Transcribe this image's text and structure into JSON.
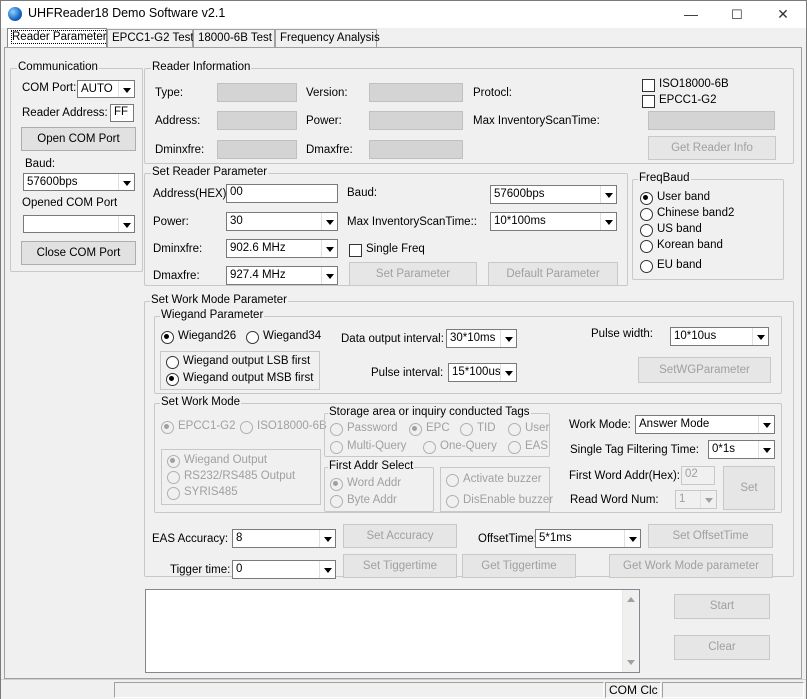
{
  "window": {
    "title": "UHFReader18 Demo Software v2.1",
    "minimize": "—",
    "maximize": "☐",
    "close": "✕"
  },
  "tabs": [
    "Reader Parameter",
    "EPCC1-G2 Test",
    "18000-6B Test",
    "Frequency Analysis"
  ],
  "communication": {
    "title": "Communication",
    "com_port_label": "COM Port:",
    "com_port_value": "AUTO",
    "reader_address_label": "Reader Address:",
    "reader_address_value": "FF",
    "open_com_port": "Open COM Port",
    "baud_label": "Baud:",
    "baud_value": "57600bps",
    "opened_com_port_label": "Opened COM Port",
    "opened_com_port_value": "",
    "close_com_port": "Close COM Port"
  },
  "reader_info": {
    "title": "Reader Information",
    "type_label": "Type:",
    "version_label": "Version:",
    "protocol_label": "Protocl:",
    "address_label": "Address:",
    "power_label": "Power:",
    "max_inv_label": "Max InventoryScanTime:",
    "dminfre_label": "Dminxfre:",
    "dmaxfre_label": "Dmaxfre:",
    "iso_label": "ISO18000-6B",
    "epc_label": "EPCC1-G2",
    "get_reader_info": "Get Reader Info"
  },
  "set_reader_param": {
    "title": "Set Reader Parameter",
    "address_label": "Address(HEX):",
    "address_value": "00",
    "baud_label": "Baud:",
    "baud_value": "57600bps",
    "power_label": "Power:",
    "power_value": "30",
    "max_inv_label": "Max InventoryScanTime::",
    "max_inv_value": "10*100ms",
    "dminfre_label": "Dminxfre:",
    "dminfre_value": "902.6 MHz",
    "single_freq_label": "Single Freq",
    "dmaxfre_label": "Dmaxfre:",
    "dmaxfre_value": "927.4 MHz",
    "set_parameter": "Set Parameter",
    "default_parameter": "Default Parameter"
  },
  "freq_band": {
    "title": "FreqBaud",
    "options": [
      "User band",
      "Chinese band2",
      "US band",
      "Korean band",
      "EU band"
    ],
    "selected": "User band"
  },
  "work_mode_param": {
    "title": "Set Work Mode Parameter",
    "wiegand_title": "Wiegand Parameter",
    "wiegand26": "Wiegand26",
    "wiegand34": "Wiegand34",
    "data_output_interval_label": "Data output interval:",
    "data_output_interval_value": "30*10ms",
    "pulse_width_label": "Pulse width:",
    "pulse_width_value": "10*10us",
    "lsb_first": "Wiegand output LSB first",
    "msb_first": "Wiegand output MSB first",
    "pulse_interval_label": "Pulse interval:",
    "pulse_interval_value": "15*100us",
    "set_wg_parameter": "SetWGParameter"
  },
  "set_work_mode": {
    "title": "Set Work Mode",
    "epcc1g2": "EPCC1-G2",
    "iso18000": "ISO18000-6B",
    "storage_title": "Storage area or inquiry conducted Tags",
    "password": "Password",
    "epc": "EPC",
    "tid": "TID",
    "user": "User",
    "multi_query": "Multi-Query",
    "one_query": "One-Query",
    "eas": "EAS",
    "wiegand_output": "Wiegand Output",
    "rs232": "RS232/RS485 Output",
    "syris": "SYRIS485",
    "first_addr_title": "First Addr Select",
    "word_addr": "Word Addr",
    "byte_addr": "Byte Addr",
    "activate_buzzer": "Activate buzzer",
    "disable_buzzer": "DisEnable buzzer",
    "work_mode_label": "Work Mode:",
    "work_mode_value": "Answer Mode",
    "single_tag_label": "Single Tag Filtering Time:",
    "single_tag_value": "0*1s",
    "first_word_label": "First Word Addr(Hex):",
    "first_word_value": "02",
    "read_word_num_label": "Read Word Num:",
    "read_word_num_value": "1",
    "set": "Set"
  },
  "eas": {
    "accuracy_label": "EAS Accuracy:",
    "accuracy_value": "8",
    "set_accuracy": "Set Accuracy",
    "offset_label": "OffsetTime:",
    "offset_value": "5*1ms",
    "set_offset": "Set OffsetTime",
    "tigger_label": "Tigger time:",
    "tigger_value": "0",
    "set_tigger": "Set Tiggertime",
    "get_tigger": "Get Tiggertime",
    "get_work_mode": "Get Work Mode parameter"
  },
  "actions": {
    "start": "Start",
    "clear": "Clear"
  },
  "status": {
    "panel": "COM Clc"
  }
}
